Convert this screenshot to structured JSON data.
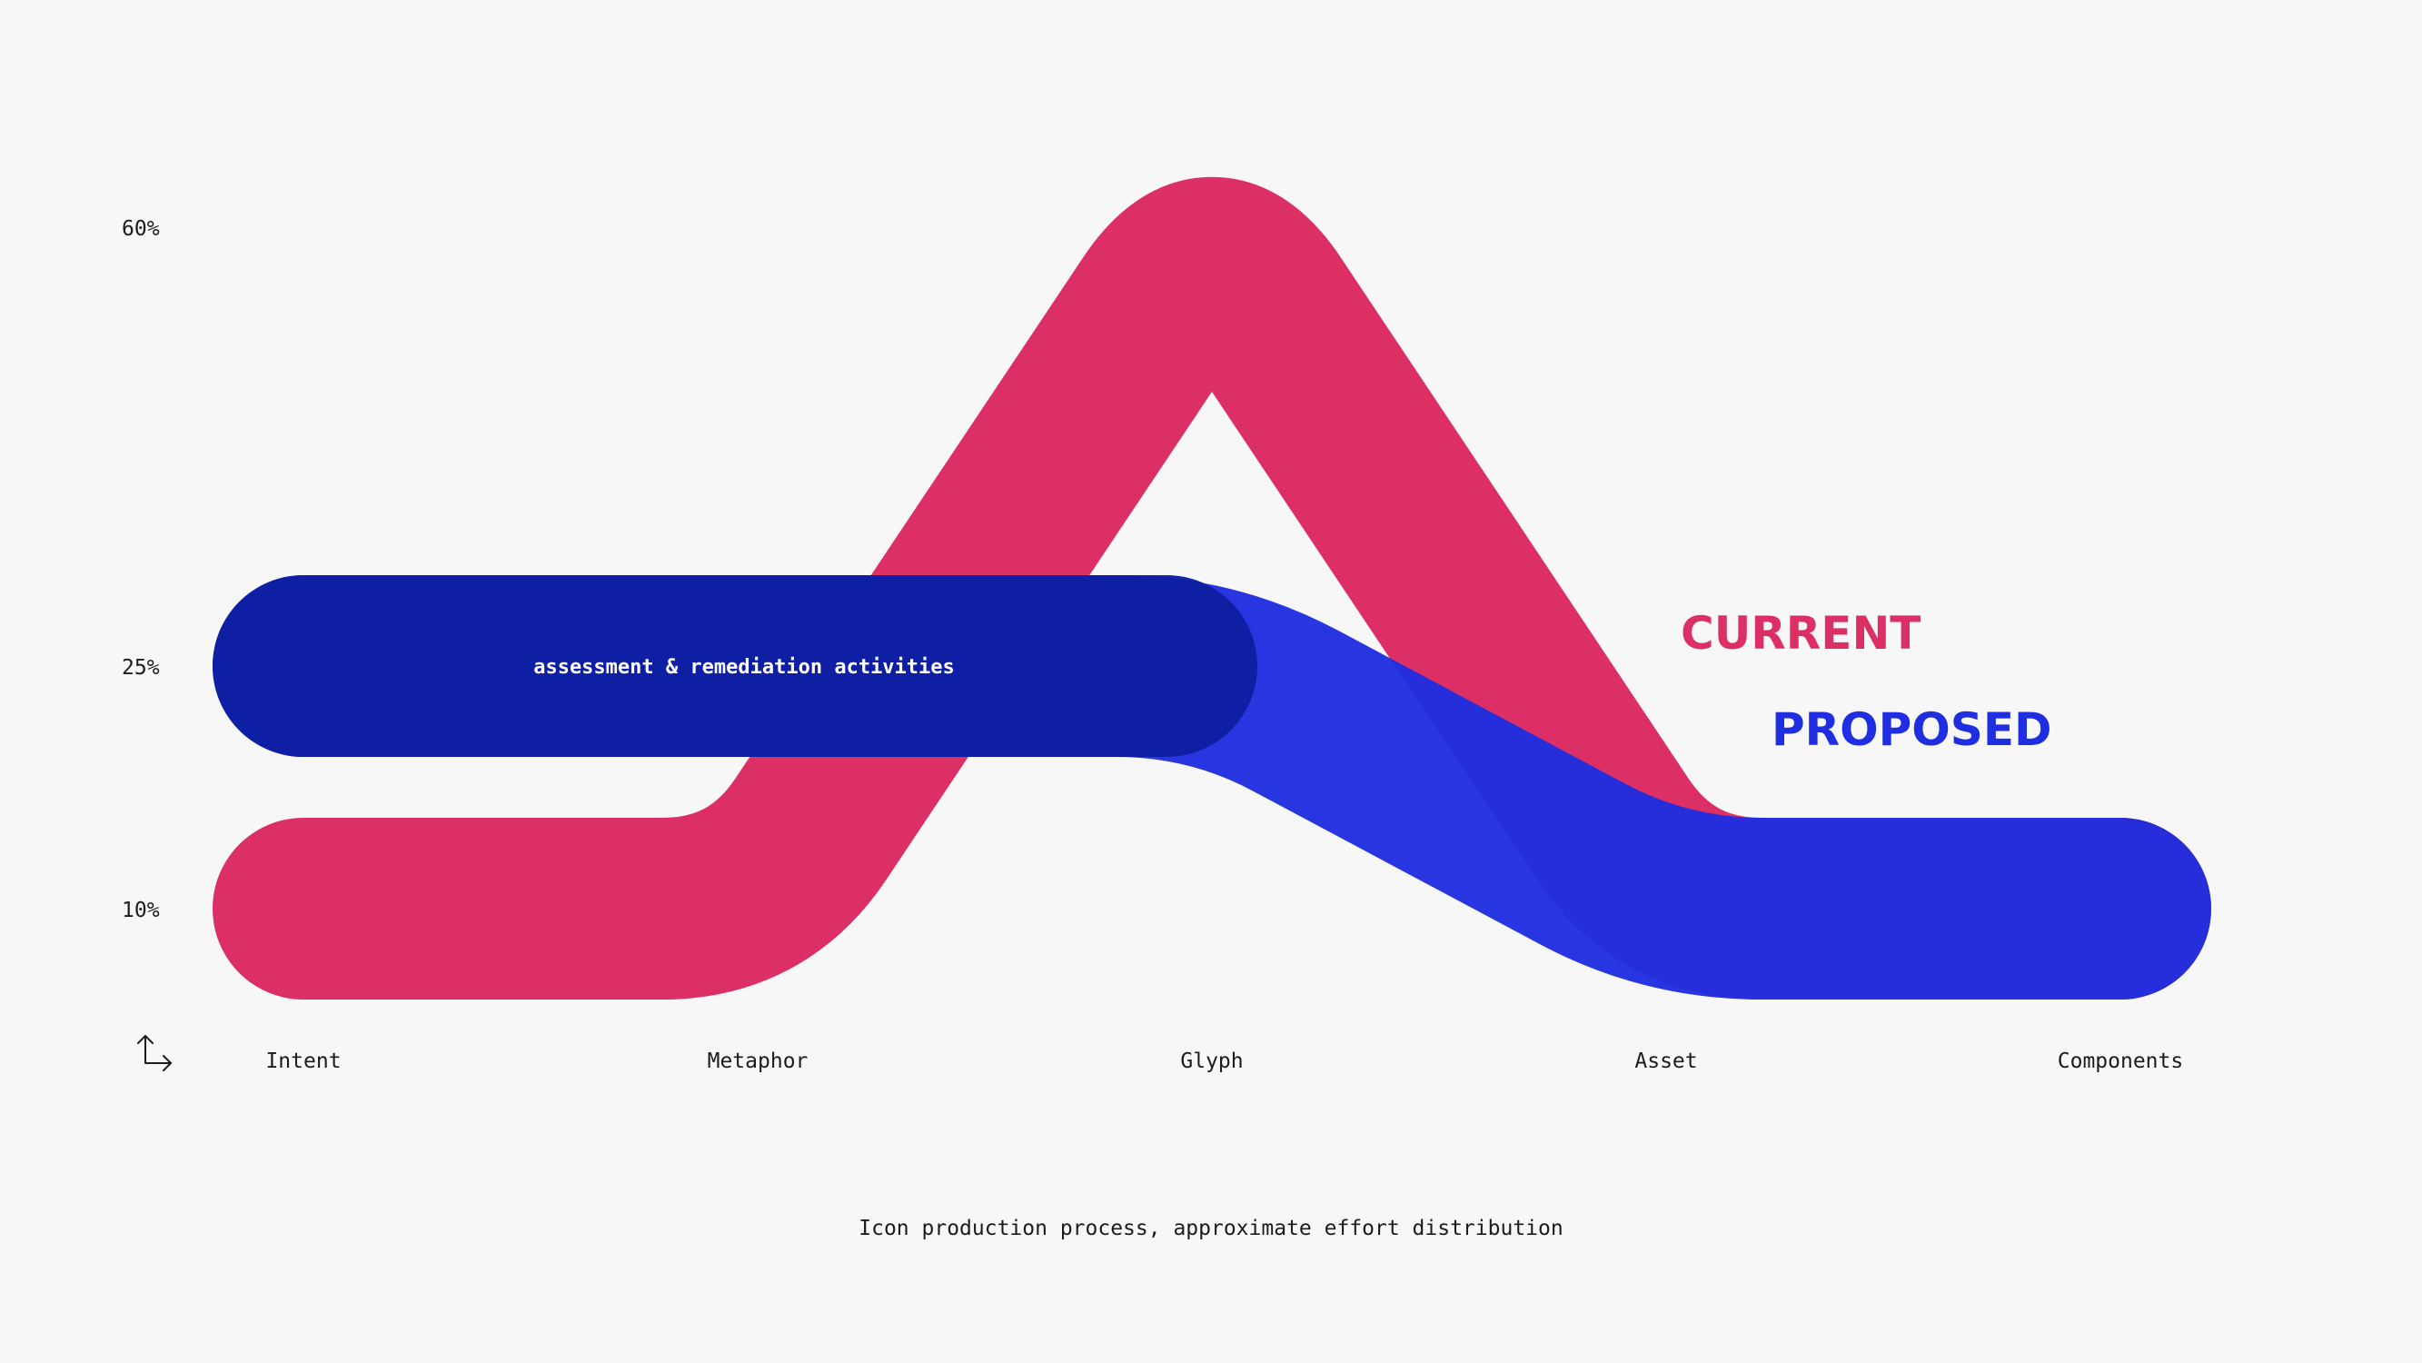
{
  "chart_data": {
    "type": "line",
    "categories": [
      "Intent",
      "Metaphor",
      "Glyph",
      "Asset",
      "Components"
    ],
    "y_ticks": [
      "10%",
      "25%",
      "60%"
    ],
    "y_tick_values": [
      10,
      25,
      60
    ],
    "series": [
      {
        "name": "CURRENT",
        "values": [
          10,
          10,
          60,
          10,
          10
        ],
        "color": "#dc2f65"
      },
      {
        "name": "PROPOSED",
        "values": [
          25,
          25,
          25,
          10,
          10
        ],
        "color": "#1e2ee0"
      }
    ],
    "annotation": "assessment & remediation activities",
    "annotation_span": [
      "Intent",
      "Glyph"
    ],
    "annotation_color": "#0f1fa3",
    "caption": "Icon production process, approximate effort distribution",
    "grid": false,
    "legend_placement": "inline-right"
  },
  "icons": {
    "axes": "axes-corner-icon"
  }
}
